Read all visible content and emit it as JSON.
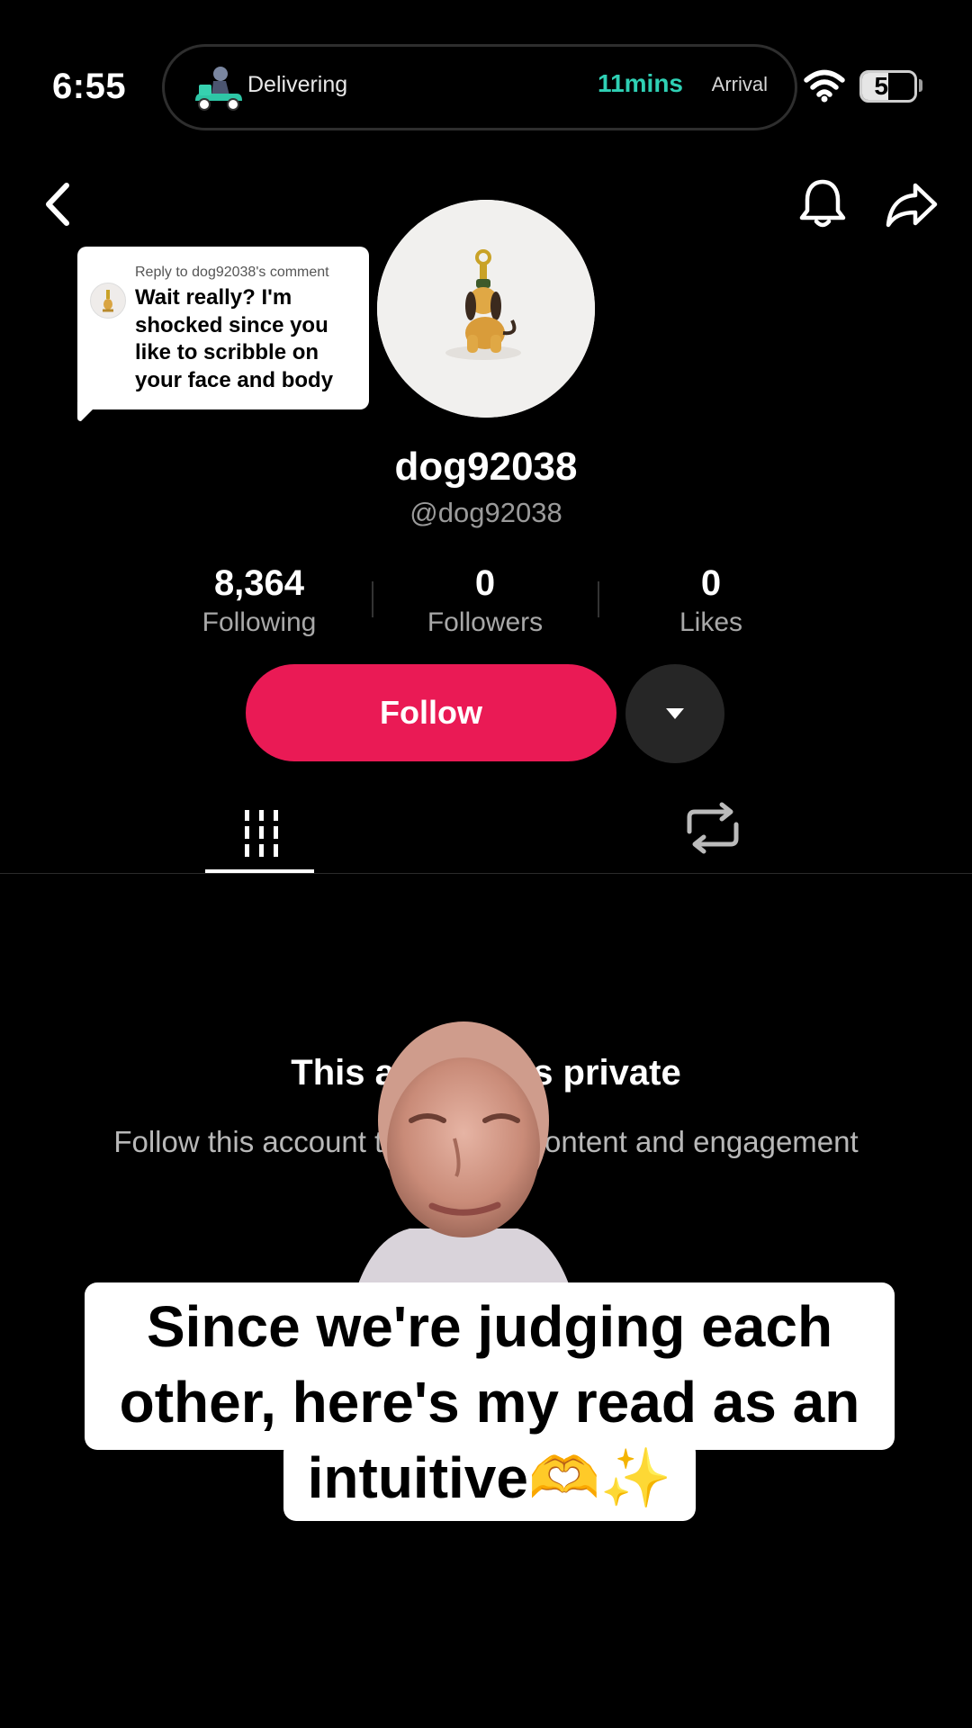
{
  "status_bar": {
    "time": "6:55",
    "live_activity": {
      "label": "Delivering",
      "eta": "11mins",
      "eta_label": "Arrival"
    },
    "battery": {
      "level": 50,
      "text": "50"
    }
  },
  "reply": {
    "header": "Reply to dog92038's comment",
    "text": "Wait really? I'm shocked since you like to scribble on your face and body"
  },
  "profile": {
    "display_name": "dog92038",
    "handle": "@dog92038",
    "stats": [
      {
        "value": "8,364",
        "label": "Following"
      },
      {
        "value": "0",
        "label": "Followers"
      },
      {
        "value": "0",
        "label": "Likes"
      }
    ],
    "follow_label": "Follow"
  },
  "tabs": {
    "active": "videos"
  },
  "private": {
    "title": "This account is private",
    "subtitle": "Follow this account to see their content and engagement"
  },
  "caption": {
    "text": "Since we're judging each other, here's my read as an intuitive🫶✨"
  },
  "colors": {
    "accent": "#ea1a55",
    "eta": "#2fd0b4",
    "background": "#000000"
  },
  "icons": [
    "back-icon",
    "bell-icon",
    "share-icon",
    "dropdown-caret-icon",
    "grid-icon",
    "repost-icon",
    "wifi-icon",
    "battery-icon"
  ]
}
